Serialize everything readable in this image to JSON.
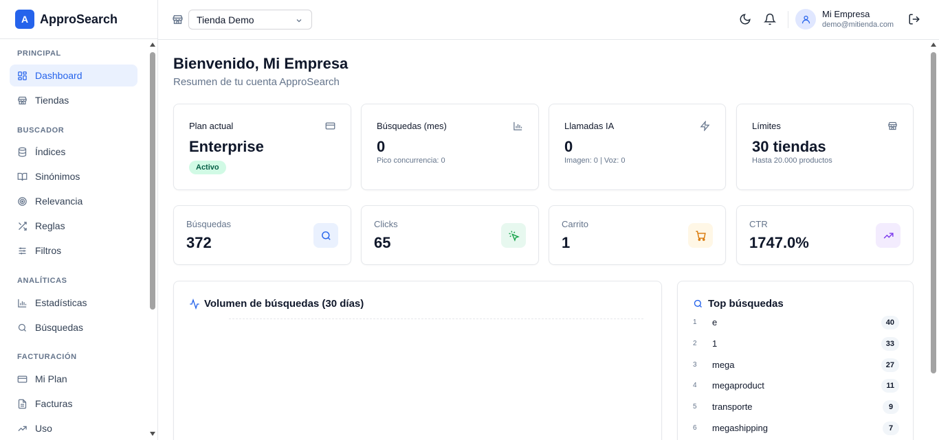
{
  "brand": {
    "logo_letter": "A",
    "name": "ApproSearch",
    "accent": "#2563eb"
  },
  "sidebar": {
    "sections": [
      {
        "title": "PRINCIPAL",
        "items": [
          {
            "label": "Dashboard",
            "icon": "dashboard-icon",
            "active": true
          },
          {
            "label": "Tiendas",
            "icon": "store-icon",
            "active": false
          }
        ]
      },
      {
        "title": "BUSCADOR",
        "items": [
          {
            "label": "Índices",
            "icon": "database-icon"
          },
          {
            "label": "Sinónimos",
            "icon": "book-icon"
          },
          {
            "label": "Relevancia",
            "icon": "target-icon"
          },
          {
            "label": "Reglas",
            "icon": "shuffle-icon"
          },
          {
            "label": "Filtros",
            "icon": "sliders-icon"
          }
        ]
      },
      {
        "title": "ANALÍTICAS",
        "items": [
          {
            "label": "Estadísticas",
            "icon": "bar-chart-icon"
          },
          {
            "label": "Búsquedas",
            "icon": "search-icon"
          }
        ]
      },
      {
        "title": "FACTURACIÓN",
        "items": [
          {
            "label": "Mi Plan",
            "icon": "credit-card-icon"
          },
          {
            "label": "Facturas",
            "icon": "file-icon"
          },
          {
            "label": "Uso",
            "icon": "trending-up-icon"
          }
        ]
      }
    ]
  },
  "topbar": {
    "store_select": "Tienda Demo",
    "user_name": "Mi Empresa",
    "user_email": "demo@mitienda.com"
  },
  "header": {
    "title": "Bienvenido, Mi Empresa",
    "subtitle": "Resumen de tu cuenta ApproSearch"
  },
  "summary_cards": [
    {
      "label": "Plan actual",
      "value": "Enterprise",
      "badge": "Activo",
      "icon": "credit-card-icon"
    },
    {
      "label": "Búsquedas (mes)",
      "value": "0",
      "detail": "Pico concurrencia: 0",
      "icon": "bar-chart-icon"
    },
    {
      "label": "Llamadas IA",
      "value": "0",
      "detail": "Imagen: 0 | Voz: 0",
      "icon": "zap-icon"
    },
    {
      "label": "Límites",
      "value": "30 tiendas",
      "detail": "Hasta 20.000 productos",
      "icon": "store-icon"
    }
  ],
  "metric_cards": [
    {
      "label": "Búsquedas",
      "value": "372",
      "icon": "search-icon",
      "tile_bg": "#eaf1fe",
      "color": "#2563eb"
    },
    {
      "label": "Clicks",
      "value": "65",
      "icon": "pointer-click-icon",
      "tile_bg": "#e7f8ef",
      "color": "#16a34a"
    },
    {
      "label": "Carrito",
      "value": "1",
      "icon": "cart-icon",
      "tile_bg": "#fff7e6",
      "color": "#d97706"
    },
    {
      "label": "CTR",
      "value": "1747.0%",
      "icon": "trending-up-icon",
      "tile_bg": "#f3ecfe",
      "color": "#7c3aed"
    }
  ],
  "volume_panel": {
    "title": "Volumen de búsquedas (30 días)"
  },
  "top_searches": {
    "title": "Top búsquedas",
    "rows": [
      {
        "rank": "1",
        "term": "e",
        "count": "40"
      },
      {
        "rank": "2",
        "term": "1",
        "count": "33"
      },
      {
        "rank": "3",
        "term": "mega",
        "count": "27"
      },
      {
        "rank": "4",
        "term": "megaproduct",
        "count": "11"
      },
      {
        "rank": "5",
        "term": "transporte",
        "count": "9"
      },
      {
        "rank": "6",
        "term": "megashipping",
        "count": "7"
      }
    ]
  }
}
